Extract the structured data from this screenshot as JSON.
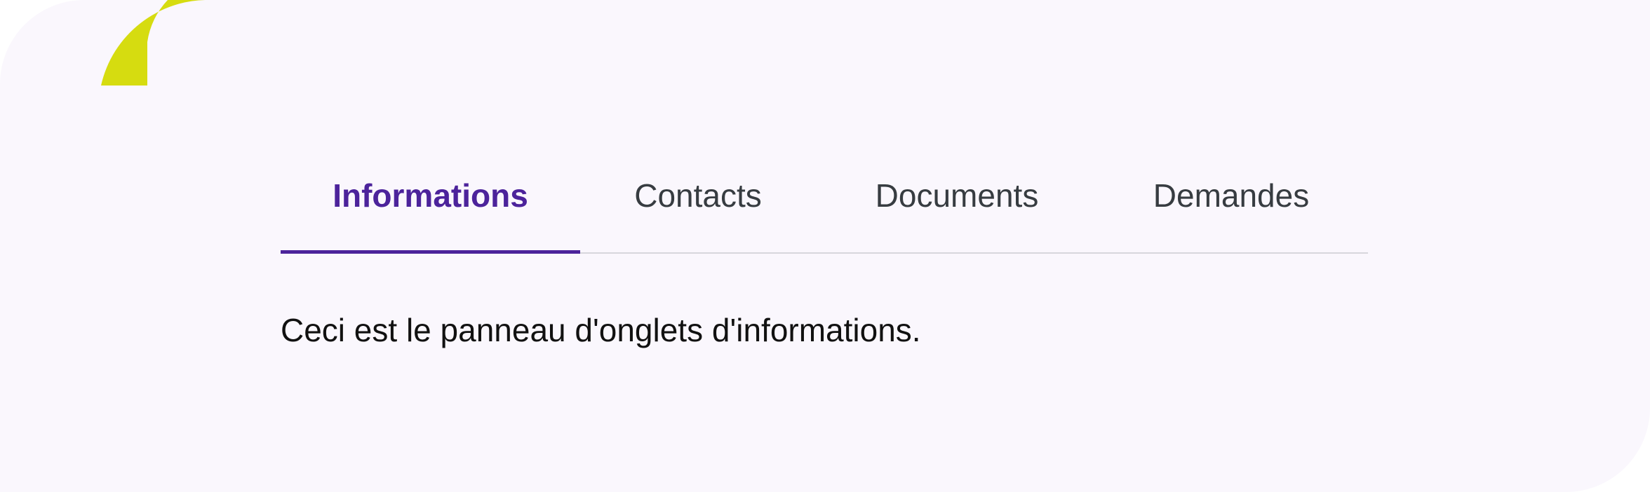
{
  "tabs": [
    {
      "label": "Informations",
      "active": true
    },
    {
      "label": "Contacts",
      "active": false
    },
    {
      "label": "Documents",
      "active": false
    },
    {
      "label": "Demandes",
      "active": false
    }
  ],
  "panel": {
    "text": "Ceci est le panneau d'onglets d'informations."
  },
  "colors": {
    "background": "#faf7fd",
    "accent": "#4c239b",
    "decoration": "#d6dc10",
    "tab_text": "#373c41",
    "divider": "#d7d6dc"
  },
  "icons": {
    "decoration": "lime-arc-decoration-icon"
  }
}
